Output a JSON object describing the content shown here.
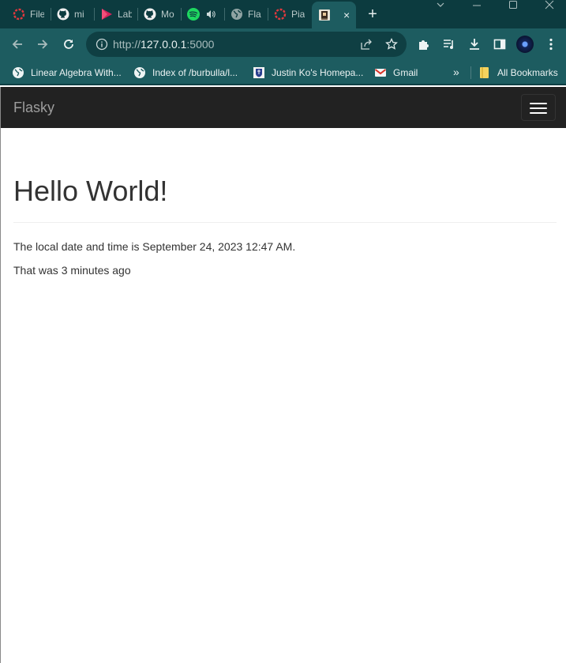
{
  "browser": {
    "tabs": [
      {
        "label": "File",
        "icon": "opera-ring-icon"
      },
      {
        "label": "mi",
        "icon": "github-icon"
      },
      {
        "label": "Lab",
        "icon": "play-icon"
      },
      {
        "label": "Mo",
        "icon": "github-icon"
      },
      {
        "label": "",
        "icon": "spotify-icon"
      },
      {
        "label": "Fla",
        "icon": "globe-icon"
      },
      {
        "label": "Pia",
        "icon": "opera-ring-icon"
      }
    ],
    "active_tab_close": "×",
    "new_tab": "+",
    "address": {
      "scheme": "http://",
      "host": "127.0.0.1",
      "port": ":5000"
    },
    "bookmarks": [
      {
        "label": "Linear Algebra With...",
        "icon": "globe-icon"
      },
      {
        "label": "Index of /burbulla/l...",
        "icon": "globe-icon"
      },
      {
        "label": "Justin Ko's Homepa...",
        "icon": "crest-icon"
      },
      {
        "label": "Gmail",
        "icon": "gmail-icon"
      }
    ],
    "bookmarks_overflow": "»",
    "all_bookmarks": "All Bookmarks"
  },
  "colors": {
    "frame": "#0c3b3f",
    "toolbar": "#1d5c60",
    "navbar": "#222222",
    "brand_text": "#9d9d9d",
    "body_text": "#333333"
  },
  "page": {
    "brand": "Flasky",
    "heading": "Hello World!",
    "datetime_line": "The local date and time is September 24, 2023 12:47 AM.",
    "relative_line": "That was 3 minutes ago"
  }
}
